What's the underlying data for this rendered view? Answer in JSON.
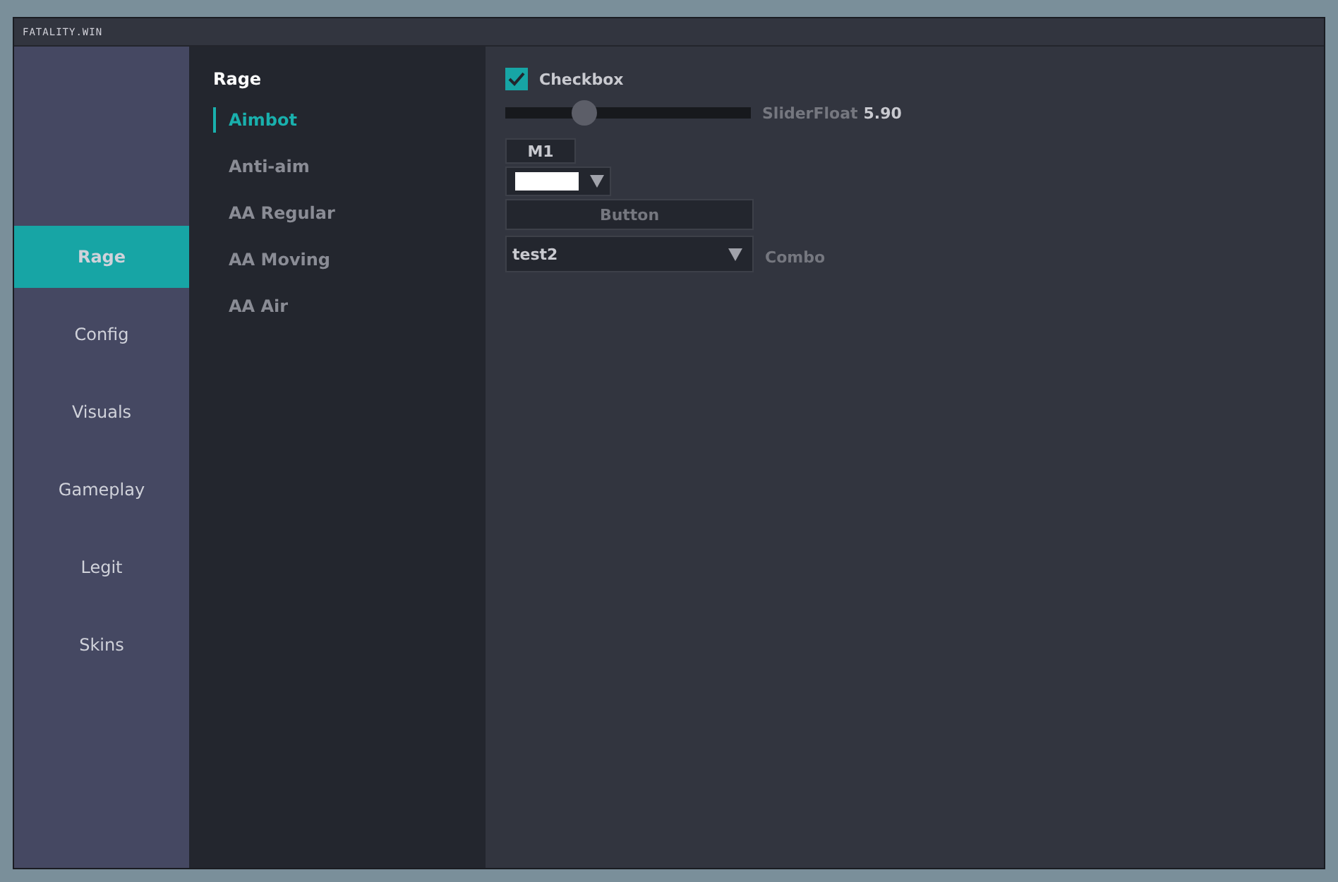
{
  "window": {
    "title": "FATALITY.WIN"
  },
  "sidebar": {
    "items": [
      {
        "label": "Rage",
        "selected": true
      },
      {
        "label": "Config",
        "selected": false
      },
      {
        "label": "Visuals",
        "selected": false
      },
      {
        "label": "Gameplay",
        "selected": false
      },
      {
        "label": "Legit",
        "selected": false
      },
      {
        "label": "Skins",
        "selected": false
      }
    ]
  },
  "subnav": {
    "heading": "Rage",
    "items": [
      {
        "label": "Aimbot",
        "selected": true
      },
      {
        "label": "Anti-aim",
        "selected": false
      },
      {
        "label": "AA Regular",
        "selected": false
      },
      {
        "label": "AA Moving",
        "selected": false
      },
      {
        "label": "AA Air",
        "selected": false
      }
    ]
  },
  "controls": [
    {
      "kind": "checkbox",
      "label": "Checkbox",
      "checked": true
    },
    {
      "kind": "slider",
      "label": "SliderFloat",
      "reading": "5.90",
      "level": 0.32
    },
    {
      "kind": "key",
      "label": "M1"
    },
    {
      "kind": "color",
      "color": "#ffffff"
    },
    {
      "kind": "button",
      "label": "Button"
    },
    {
      "kind": "combo",
      "value": "test2",
      "label": "Combo"
    }
  ]
}
